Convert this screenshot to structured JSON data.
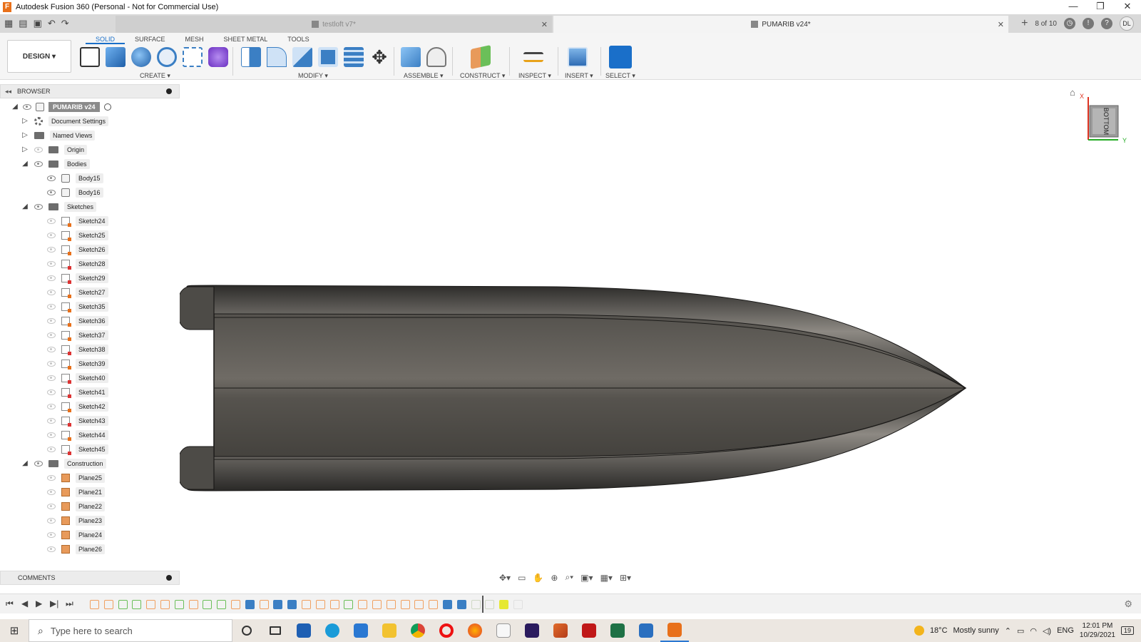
{
  "window": {
    "title": "Autodesk Fusion 360 (Personal - Not for Commercial Use)",
    "minimize": "—",
    "restore": "❐",
    "close": "✕"
  },
  "tabs": {
    "doc1": "testloft v7*",
    "doc2": "PUMARIB v24*",
    "jobs": "8 of 10",
    "user_initials": "DL",
    "help": "?"
  },
  "ribbon": {
    "workspace": "DESIGN ▾",
    "tabs": [
      "SOLID",
      "SURFACE",
      "MESH",
      "SHEET METAL",
      "TOOLS"
    ],
    "groups": {
      "create": "CREATE ▾",
      "modify": "MODIFY ▾",
      "assemble": "ASSEMBLE ▾",
      "construct": "CONSTRUCT ▾",
      "inspect": "INSPECT ▾",
      "insert": "INSERT ▾",
      "select": "SELECT ▾"
    }
  },
  "browser": {
    "header": "BROWSER",
    "root": "PUMARIB v24",
    "folders": {
      "document_settings": "Document Settings",
      "named_views": "Named Views",
      "origin": "Origin",
      "bodies": "Bodies",
      "sketches": "Sketches",
      "construction": "Construction"
    },
    "bodies": [
      "Body15",
      "Body16"
    ],
    "sketches": [
      "Sketch24",
      "Sketch25",
      "Sketch26",
      "Sketch28",
      "Sketch29",
      "Sketch27",
      "Sketch35",
      "Sketch36",
      "Sketch37",
      "Sketch38",
      "Sketch39",
      "Sketch40",
      "Sketch41",
      "Sketch42",
      "Sketch43",
      "Sketch44",
      "Sketch45"
    ],
    "sketch_red_flags": [
      false,
      false,
      false,
      true,
      true,
      false,
      false,
      false,
      false,
      true,
      false,
      true,
      true,
      false,
      true,
      false,
      true
    ],
    "planes": [
      "Plane25",
      "Plane21",
      "Plane22",
      "Plane23",
      "Plane24",
      "Plane26"
    ]
  },
  "comments": {
    "label": "COMMENTS"
  },
  "viewcube": {
    "face": "BOTTOM",
    "axis_x": "X",
    "axis_y": "Y"
  },
  "taskbar": {
    "search_placeholder": "Type here to search",
    "weather_temp": "18°C",
    "weather_text": "Mostly sunny",
    "language": "ENG",
    "time": "12:01 PM",
    "date": "10/29/2021",
    "notifications": "19"
  },
  "colors": {
    "accent": "#1a6fc9",
    "hull_dark": "#3f3d39",
    "hull_light": "#7a7670",
    "fusion_orange": "#e8701a"
  }
}
